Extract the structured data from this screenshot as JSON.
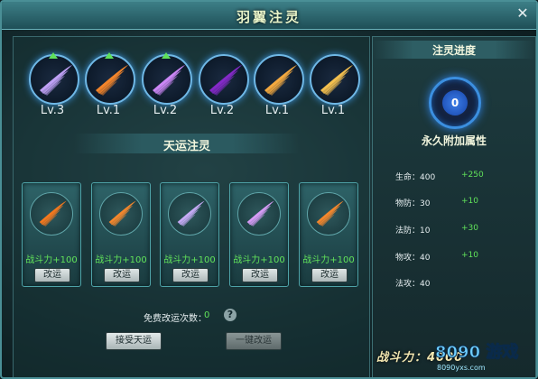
{
  "window": {
    "title": "羽翼注灵",
    "close_glyph": "✕"
  },
  "wings": [
    {
      "level": "Lv.3",
      "color": "#c8a8ff",
      "upgradable": true
    },
    {
      "level": "Lv.1",
      "color": "#ff8a2a",
      "upgradable": true
    },
    {
      "level": "Lv.2",
      "color": "#d58cff",
      "upgradable": true
    },
    {
      "level": "Lv.2",
      "color": "#8a2ad0",
      "upgradable": false
    },
    {
      "level": "Lv.1",
      "color": "#ffb040",
      "upgradable": false
    },
    {
      "level": "Lv.1",
      "color": "#ffc850",
      "upgradable": false
    }
  ],
  "fortune": {
    "title": "天运注灵",
    "cards": [
      {
        "bonus": "战斗力+100",
        "button": "改运",
        "color": "#ff7a1a"
      },
      {
        "bonus": "战斗力+100",
        "button": "改运",
        "color": "#ff8a2a"
      },
      {
        "bonus": "战斗力+100",
        "button": "改运",
        "color": "#d0b0ff"
      },
      {
        "bonus": "战斗力+100",
        "button": "改运",
        "color": "#e0a0ff"
      },
      {
        "bonus": "战斗力+100",
        "button": "改运",
        "color": "#ff8a2a"
      }
    ],
    "free_label": "免费改运次数：",
    "free_count": "0",
    "help": "?",
    "accept_button": "接受天运",
    "oneclick_button": "一键改运"
  },
  "progress": {
    "title": "注灵进度",
    "value": "0",
    "subtitle": "永久附加属性",
    "attributes": [
      {
        "name": "生命：400",
        "bonus": "+250"
      },
      {
        "name": "物防：30",
        "bonus": "+10"
      },
      {
        "name": "法防：10",
        "bonus": "+30"
      },
      {
        "name": "物攻：40",
        "bonus": "+10"
      },
      {
        "name": "法攻：40",
        "bonus": ""
      }
    ],
    "combat_power": "战斗力：4000"
  },
  "watermark": {
    "text": "8090 游戏",
    "site": "8090yxs.com"
  }
}
